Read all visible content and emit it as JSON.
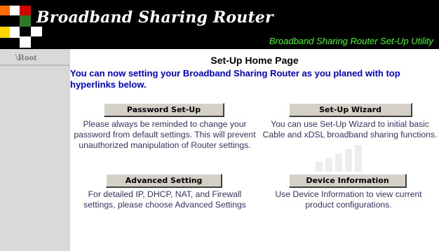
{
  "header": {
    "brand_title": "Broadband Sharing Router",
    "utility_title": "Broadband Sharing Router Set-Up Utility"
  },
  "sidebar": {
    "root_link": "\\Root"
  },
  "main": {
    "page_title": "Set-Up Home Page",
    "intro": "You can now setting your Broadband Sharing Router as you planed with top hyperlinks below.",
    "sections": [
      {
        "button_label": "Password Set-Up",
        "description": "Please always be reminded to change your password from default settings. This will prevent unauthorized manipulation of Router settings."
      },
      {
        "button_label": "Set-Up Wizard",
        "description": "You can use Set-Up Wizard to initial basic Cable and xDSL broadband sharing functions."
      },
      {
        "button_label": "Advanced  Setting",
        "description": "For detailed IP, DHCP, NAT, and Firewall settings, please choose Advanced Settings"
      },
      {
        "button_label": "Device Information",
        "description": "Use Device Information to view current product configurations."
      }
    ]
  },
  "colors": {
    "header_bg": "#000000",
    "utility_title": "#39ff14",
    "intro_text": "#0000cc",
    "sidebar_bg": "#d9d9d9",
    "button_face": "#d4d0c8"
  }
}
